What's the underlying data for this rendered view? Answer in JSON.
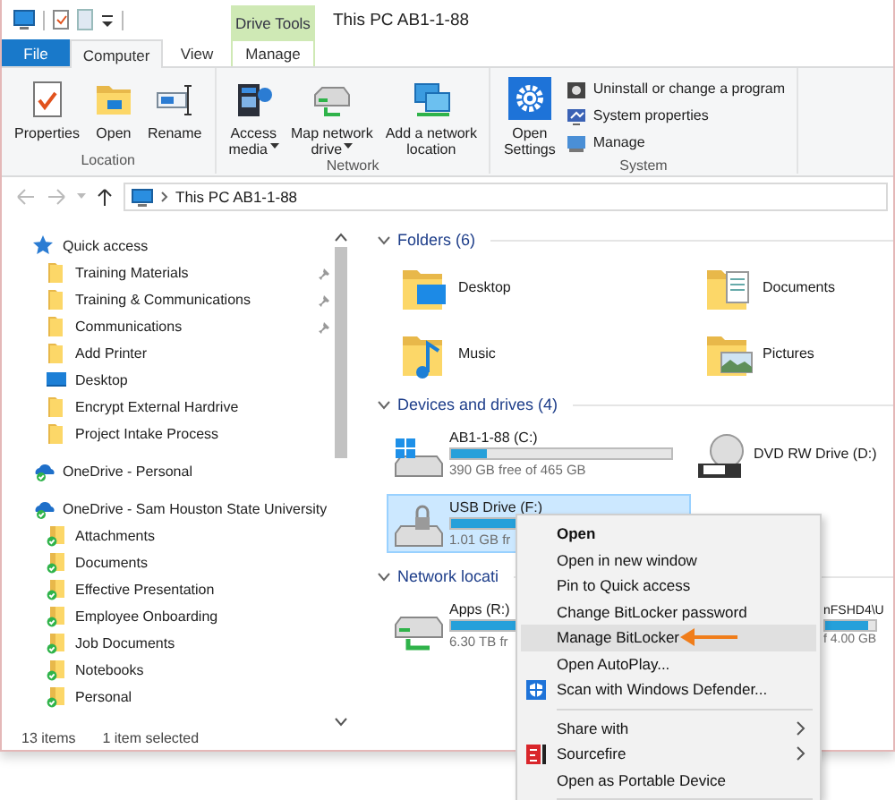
{
  "window": {
    "title": "This PC AB1-1-88",
    "context_tab": "Drive Tools"
  },
  "tabs": [
    {
      "label": "File",
      "kind": "file",
      "selected": false
    },
    {
      "label": "Computer",
      "kind": "tab",
      "selected": true
    },
    {
      "label": "View",
      "kind": "tab",
      "selected": false
    },
    {
      "label": "Manage",
      "kind": "context",
      "selected": false
    }
  ],
  "ribbon": {
    "groups": [
      {
        "name": "Location",
        "buttons": [
          {
            "label": "Properties",
            "kind": "properties",
            "dropdown": false
          },
          {
            "label": "Open",
            "kind": "open",
            "dropdown": false
          },
          {
            "label": "Rename",
            "kind": "rename",
            "dropdown": false
          }
        ]
      },
      {
        "name": "Network",
        "buttons": [
          {
            "label": "Access\nmedia",
            "kind": "media",
            "dropdown": true
          },
          {
            "label": "Map network\ndrive",
            "kind": "map-drive",
            "dropdown": true
          },
          {
            "label": "Add a network\nlocation",
            "kind": "network-location",
            "dropdown": false
          }
        ]
      },
      {
        "name": "System",
        "buttons": [
          {
            "label": "Open\nSettings",
            "kind": "settings",
            "dropdown": false
          }
        ],
        "small_buttons": [
          {
            "label": "Uninstall or change a program",
            "kind": "uninstall"
          },
          {
            "label": "System properties",
            "kind": "system-properties"
          },
          {
            "label": "Manage",
            "kind": "manage"
          }
        ]
      }
    ]
  },
  "address": {
    "path": "This PC AB1-1-88"
  },
  "nav_pane": {
    "items": [
      {
        "label": "Quick access",
        "kind": "quick-access",
        "children": [
          {
            "label": "Training Materials",
            "kind": "folder",
            "pinned": true
          },
          {
            "label": "Training & Communications",
            "kind": "folder",
            "pinned": true
          },
          {
            "label": "Communications",
            "kind": "folder",
            "pinned": true
          },
          {
            "label": "Add Printer",
            "kind": "folder",
            "pinned": false
          },
          {
            "label": "Desktop",
            "kind": "desktop",
            "pinned": false
          },
          {
            "label": "Encrypt External Hardrive",
            "kind": "folder",
            "pinned": false
          },
          {
            "label": "Project Intake Process",
            "kind": "folder",
            "pinned": false
          }
        ]
      },
      {
        "label": "OneDrive - Personal",
        "kind": "cloud"
      },
      {
        "label": "OneDrive - Sam Houston State University",
        "kind": "cloud",
        "children": [
          {
            "label": "Attachments",
            "kind": "synced-folder",
            "pinned": false
          },
          {
            "label": "Documents",
            "kind": "synced-folder",
            "pinned": false
          },
          {
            "label": "Effective Presentation",
            "kind": "synced-folder",
            "pinned": false
          },
          {
            "label": "Employee Onboarding",
            "kind": "synced-folder",
            "pinned": false
          },
          {
            "label": "Job Documents",
            "kind": "synced-folder",
            "pinned": false
          },
          {
            "label": "Notebooks",
            "kind": "synced-folder",
            "pinned": false
          },
          {
            "label": "Personal",
            "kind": "synced-folder",
            "pinned": false
          }
        ]
      }
    ]
  },
  "content": {
    "groups": [
      {
        "title": "Folders (6)",
        "kind": "folders",
        "items": [
          {
            "label": "Desktop",
            "kind": "desktop"
          },
          {
            "label": "Documents",
            "kind": "documents"
          },
          {
            "label": "Music",
            "kind": "music"
          },
          {
            "label": "Pictures",
            "kind": "pictures"
          }
        ]
      },
      {
        "title": "Devices and drives (4)",
        "kind": "drives",
        "items": [
          {
            "label": "AB1-1-88 (C:)",
            "kind": "system-drive",
            "level": 0.16,
            "detail": "390 GB free of 465 GB",
            "selected": false
          },
          {
            "label": "DVD RW Drive (D:)",
            "kind": "dvd",
            "selected": false
          },
          {
            "label": "USB Drive (F:)",
            "kind": "usb",
            "level": 0.5,
            "detail": "1.01 GB fr",
            "selected": true
          }
        ]
      },
      {
        "title": "Network locati",
        "kind": "drives",
        "items": [
          {
            "label": "Apps (R:)",
            "kind": "network-drive",
            "level": 0.8,
            "detail": "6.30 TB fr",
            "selected": false
          },
          {
            "label": "nFSHD4\\U",
            "kind": "partial",
            "level": 0.85,
            "detail": "f 4.00 GB",
            "selected": false
          }
        ]
      }
    ]
  },
  "status_bar": {
    "count": "13 items",
    "selection": "1 item selected"
  },
  "context_menu": {
    "items": [
      {
        "label": "Open",
        "kind": "item",
        "default": true,
        "selected": false,
        "submenu": false
      },
      {
        "label": "Open in new window",
        "kind": "item",
        "default": false,
        "selected": false,
        "submenu": false
      },
      {
        "label": "Pin to Quick access",
        "kind": "item",
        "default": false,
        "selected": false,
        "submenu": false
      },
      {
        "label": "Change BitLocker password",
        "kind": "item",
        "default": false,
        "selected": false,
        "submenu": false
      },
      {
        "label": "Manage BitLocker",
        "kind": "item",
        "default": false,
        "selected": true,
        "submenu": false
      },
      {
        "label": "Open AutoPlay...",
        "kind": "item",
        "default": false,
        "selected": false,
        "submenu": false
      },
      {
        "label": "Scan with Windows Defender...",
        "kind": "defender",
        "default": false,
        "selected": false,
        "submenu": false
      },
      {
        "kind": "separator"
      },
      {
        "label": "Share with",
        "kind": "item",
        "default": false,
        "selected": false,
        "submenu": true
      },
      {
        "label": "Sourcefire",
        "kind": "sourcefire",
        "default": false,
        "selected": false,
        "submenu": true
      },
      {
        "label": "Open as Portable Device",
        "kind": "item",
        "default": false,
        "selected": false,
        "submenu": false
      },
      {
        "kind": "separator"
      }
    ]
  }
}
